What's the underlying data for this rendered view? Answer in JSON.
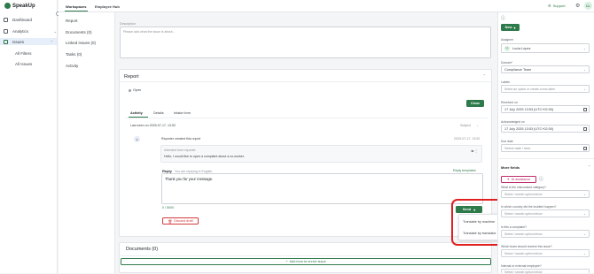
{
  "app": {
    "name": "SpeakUp"
  },
  "leftnav": {
    "items": [
      {
        "label": "Dashboard",
        "icon": "dashboard-icon"
      },
      {
        "label": "Analytics",
        "icon": "analytics-icon"
      },
      {
        "label": "Issues",
        "icon": "issues-icon"
      }
    ],
    "sub_items": [
      "All Filters",
      "All Issues"
    ]
  },
  "header": {
    "tabs": [
      "Workspaces",
      "Employee Hub"
    ],
    "support_label": "Support",
    "avatar_initials": "LL"
  },
  "subnav": {
    "items": [
      "Report",
      "Documents (0)",
      "Linked issues (0)",
      "Tasks (0)",
      "Activity"
    ]
  },
  "description": {
    "label": "Description",
    "placeholder": "Please add what the issue is about..."
  },
  "report": {
    "title": "Report",
    "status": "Open",
    "close_button": "Close",
    "tabs": [
      "Activity",
      "Details",
      "Intake form"
    ],
    "last_seen": "Last seen on 2025-07-17, 13:52",
    "subject_label": "Subject",
    "created_event": "Reporter created this report",
    "created_time": "2025-07-17, 13:52",
    "message_label": "Intended form reporter",
    "message_text": "Hello, I would like to open a complaint about a co-worker.",
    "reply_label": "Reply",
    "reply_hint": "You are replying in English",
    "reply_templates": "Reply templates",
    "reply_text": "Thank you for your message.",
    "char_count": "0 / 5000",
    "discard_button": "Discard draft",
    "send_button": "Send",
    "send_menu": [
      "Translate by machine",
      "Translate by translator"
    ]
  },
  "documents": {
    "title": "Documents (0)",
    "add_form_button": "Add form to enrich issue"
  },
  "right": {
    "new_button": "New",
    "assignee_label": "Assignee",
    "assignee_value": "Lucia López",
    "assignee_initials": "LL",
    "domain_label": "Domain*",
    "domain_value": "Compliance Team",
    "labels_label": "Labels",
    "labels_placeholder": "Select an option or create a new label",
    "received_label": "Received on",
    "received_value": "17 July 2025 13:53 (UTC+02:00)",
    "acknowledged_label": "Acknowledged on",
    "acknowledged_value": "17 July 2025 13:53 (UTC+02:00)",
    "due_label": "Due date",
    "due_placeholder": "Select date / time",
    "more_fields": "More fields",
    "ai_button": "AI assistance",
    "q1_label": "What is the misconduct category?",
    "q1_placeholder": "Select / search option below",
    "q2_label": "In which country did the incident happen?",
    "q2_placeholder": "Select / search option below",
    "q3_label": "Is this a complaint?",
    "q3_placeholder": "Select / search option below",
    "q4_label": "Which team should receive this issue?",
    "q4_placeholder": "Select / search option below",
    "q5_label": "Internal or external employee?",
    "q5_placeholder": "Select / search option below"
  },
  "colors": {
    "brand": "#2d7a4a",
    "highlight": "#e02020",
    "active_nav": "#e6eef9"
  }
}
